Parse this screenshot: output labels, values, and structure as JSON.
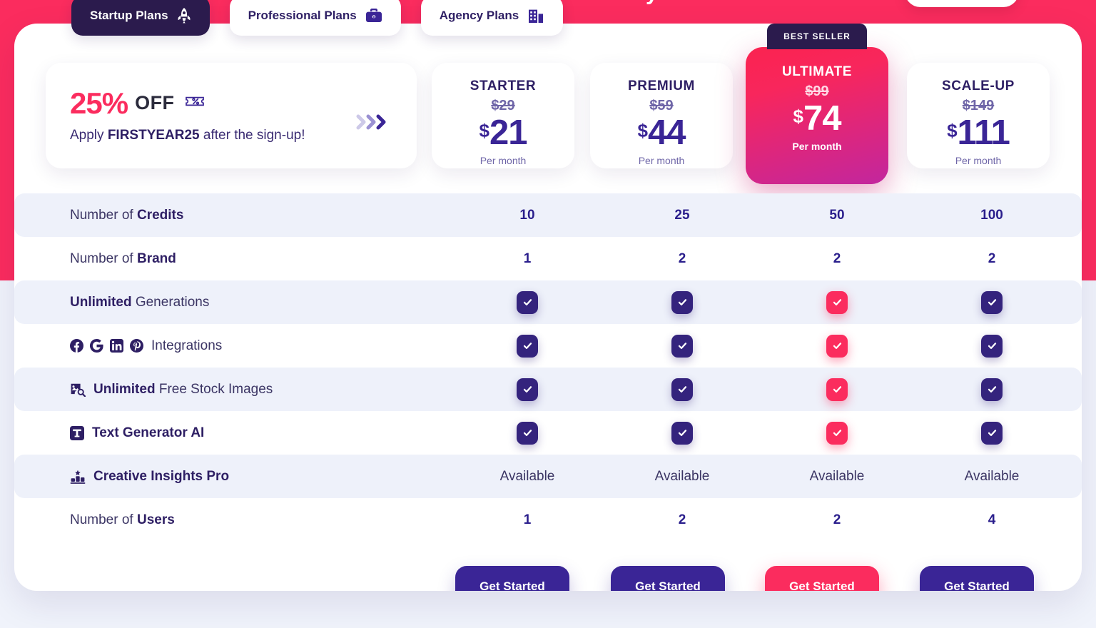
{
  "background": {
    "band_color": "#fb2c5e",
    "page_color": "#f0f3fb",
    "top_peek_text": "y"
  },
  "tabs": [
    {
      "label": "Startup Plans",
      "icon": "rocket-icon",
      "active": true
    },
    {
      "label": "Professional Plans",
      "icon": "briefcase-icon",
      "active": false
    },
    {
      "label": "Agency Plans",
      "icon": "office-building-icon",
      "active": false
    }
  ],
  "promo": {
    "percent": "25%",
    "off": "OFF",
    "coupon_icon": "percent-ticket-icon",
    "apply_prefix": "Apply ",
    "code": "FIRSTYEAR25",
    "apply_suffix": " after the sign-up!",
    "arrows_icon": "double-chevron-right-icon"
  },
  "best_seller_badge": "BEST SELLER",
  "plans": [
    {
      "name": "STARTER",
      "old_price": "$29",
      "currency": "$",
      "price": "21",
      "period": "Per month",
      "featured": false,
      "cta": "Get Started"
    },
    {
      "name": "PREMIUM",
      "old_price": "$59",
      "currency": "$",
      "price": "44",
      "period": "Per month",
      "featured": false,
      "cta": "Get Started"
    },
    {
      "name": "ULTIMATE",
      "old_price": "$99",
      "currency": "$",
      "price": "74",
      "period": "Per month",
      "featured": true,
      "cta": "Get Started"
    },
    {
      "name": "SCALE-UP",
      "old_price": "$149",
      "currency": "$",
      "price": "111",
      "period": "Per month",
      "featured": false,
      "cta": "Get Started"
    }
  ],
  "features": [
    {
      "label_plain": "Number of ",
      "label_bold": "Credits",
      "label_tail": "",
      "icons": [],
      "type": "value",
      "striped": true,
      "values": [
        "10",
        "25",
        "50",
        "100"
      ]
    },
    {
      "label_plain": "Number of ",
      "label_bold": "Brand",
      "label_tail": "",
      "icons": [],
      "type": "value",
      "striped": false,
      "values": [
        "1",
        "2",
        "2",
        "2"
      ]
    },
    {
      "label_plain": "",
      "label_bold": "Unlimited",
      "label_tail": " Generations",
      "icons": [],
      "type": "check",
      "striped": true,
      "values": [
        "check",
        "check",
        "check",
        "check"
      ]
    },
    {
      "label_plain": "",
      "label_bold": "",
      "label_tail": "Integrations",
      "icons": [
        "facebook-icon",
        "google-icon",
        "linkedin-icon",
        "pinterest-icon"
      ],
      "type": "check",
      "striped": false,
      "values": [
        "check",
        "check",
        "check",
        "check"
      ]
    },
    {
      "label_plain": "",
      "label_bold": "Unlimited",
      "label_tail": " Free Stock Images",
      "icons": [
        "image-search-icon"
      ],
      "type": "check",
      "striped": true,
      "values": [
        "check",
        "check",
        "check",
        "check"
      ]
    },
    {
      "label_plain": "",
      "label_bold": "Text Generator AI",
      "label_tail": "",
      "icons": [
        "text-tool-icon"
      ],
      "type": "check",
      "striped": false,
      "values": [
        "check",
        "check",
        "check",
        "check"
      ]
    },
    {
      "label_plain": "",
      "label_bold": "Creative Insights Pro",
      "label_tail": "",
      "icons": [
        "podium-star-icon"
      ],
      "type": "text",
      "striped": true,
      "values": [
        "Available",
        "Available",
        "Available",
        "Available"
      ]
    },
    {
      "label_plain": "Number of ",
      "label_bold": "Users",
      "label_tail": "",
      "icons": [],
      "type": "value",
      "striped": false,
      "values": [
        "1",
        "2",
        "2",
        "4"
      ]
    }
  ],
  "colors": {
    "accent_pink": "#fb2c5e",
    "indigo": "#34237d",
    "deep_purple": "#2e1f64",
    "row_stripe": "#eef1fa"
  }
}
